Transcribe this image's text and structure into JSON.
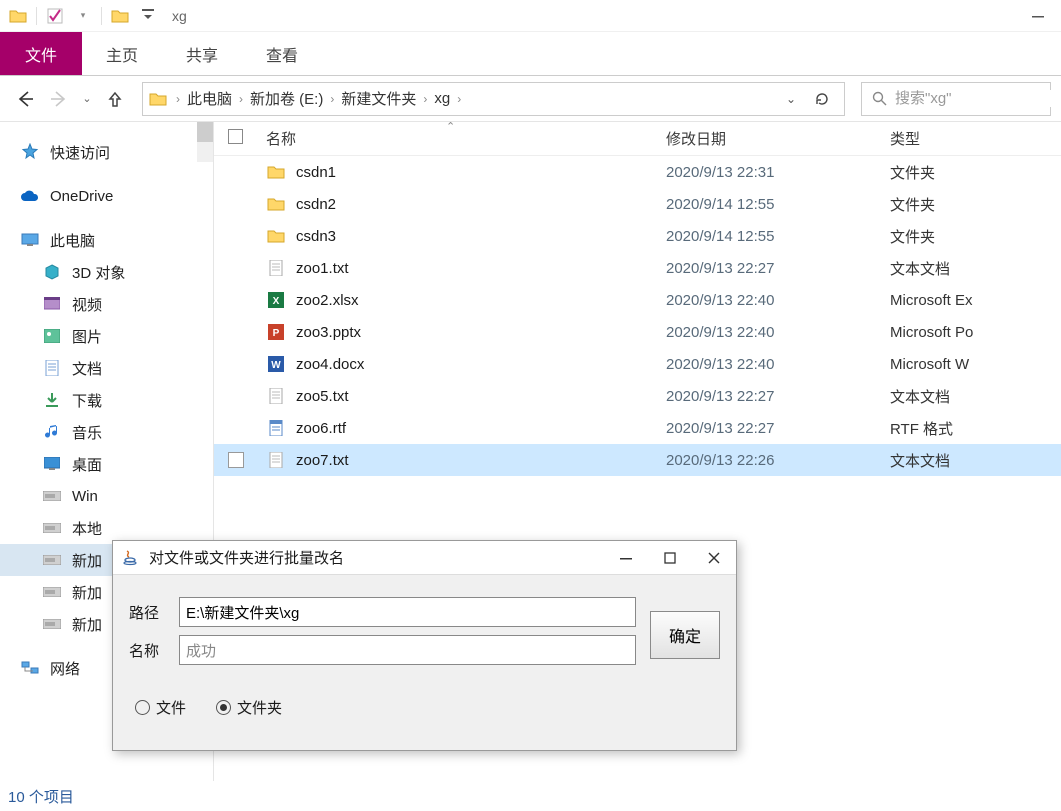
{
  "window": {
    "title": "xg"
  },
  "ribbon": {
    "file": "文件",
    "tabs": [
      "主页",
      "共享",
      "查看"
    ]
  },
  "breadcrumb": [
    "此电脑",
    "新加卷 (E:)",
    "新建文件夹",
    "xg"
  ],
  "search": {
    "placeholder": "搜索\"xg\""
  },
  "sidebar": [
    {
      "icon": "star",
      "label": "快速访问",
      "indent": false
    },
    {
      "icon": "onedrive",
      "label": "OneDrive",
      "indent": false,
      "spaceBefore": true
    },
    {
      "icon": "pc",
      "label": "此电脑",
      "indent": false,
      "spaceBefore": true
    },
    {
      "icon": "obj3d",
      "label": "3D 对象",
      "indent": true
    },
    {
      "icon": "video",
      "label": "视频",
      "indent": true
    },
    {
      "icon": "pic",
      "label": "图片",
      "indent": true
    },
    {
      "icon": "doc",
      "label": "文档",
      "indent": true
    },
    {
      "icon": "dl",
      "label": "下载",
      "indent": true
    },
    {
      "icon": "music",
      "label": "音乐",
      "indent": true
    },
    {
      "icon": "desk",
      "label": "桌面",
      "indent": true
    },
    {
      "icon": "drive",
      "label": "Win",
      "indent": true
    },
    {
      "icon": "drive",
      "label": "本地",
      "indent": true
    },
    {
      "icon": "drive",
      "label": "新加",
      "indent": true,
      "selected": true
    },
    {
      "icon": "drive",
      "label": "新加",
      "indent": true
    },
    {
      "icon": "drive",
      "label": "新加",
      "indent": true
    },
    {
      "icon": "net",
      "label": "网络",
      "indent": false,
      "spaceBefore": true
    }
  ],
  "columns": {
    "name": "名称",
    "date": "修改日期",
    "type": "类型"
  },
  "files": [
    {
      "icon": "folder",
      "name": "csdn1",
      "date": "2020/9/13 22:31",
      "type": "文件夹"
    },
    {
      "icon": "folder",
      "name": "csdn2",
      "date": "2020/9/14 12:55",
      "type": "文件夹"
    },
    {
      "icon": "folder",
      "name": "csdn3",
      "date": "2020/9/14 12:55",
      "type": "文件夹"
    },
    {
      "icon": "txt",
      "name": "zoo1.txt",
      "date": "2020/9/13 22:27",
      "type": "文本文档"
    },
    {
      "icon": "xlsx",
      "name": "zoo2.xlsx",
      "date": "2020/9/13 22:40",
      "type": "Microsoft Ex"
    },
    {
      "icon": "pptx",
      "name": "zoo3.pptx",
      "date": "2020/9/13 22:40",
      "type": "Microsoft Po"
    },
    {
      "icon": "docx",
      "name": "zoo4.docx",
      "date": "2020/9/13 22:40",
      "type": "Microsoft W"
    },
    {
      "icon": "txt",
      "name": "zoo5.txt",
      "date": "2020/9/13 22:27",
      "type": "文本文档"
    },
    {
      "icon": "rtf",
      "name": "zoo6.rtf",
      "date": "2020/9/13 22:27",
      "type": "RTF 格式"
    },
    {
      "icon": "txt",
      "name": "zoo7.txt",
      "date": "2020/9/13 22:26",
      "type": "文本文档",
      "selected": true
    }
  ],
  "status": "10 个项目",
  "dialog": {
    "title": "对文件或文件夹进行批量改名",
    "pathLabel": "路径",
    "pathValue": "E:\\新建文件夹\\xg",
    "nameLabel": "名称",
    "nameValue": "成功",
    "okLabel": "确定",
    "radios": {
      "file": "文件",
      "folder": "文件夹",
      "checked": "folder"
    }
  }
}
